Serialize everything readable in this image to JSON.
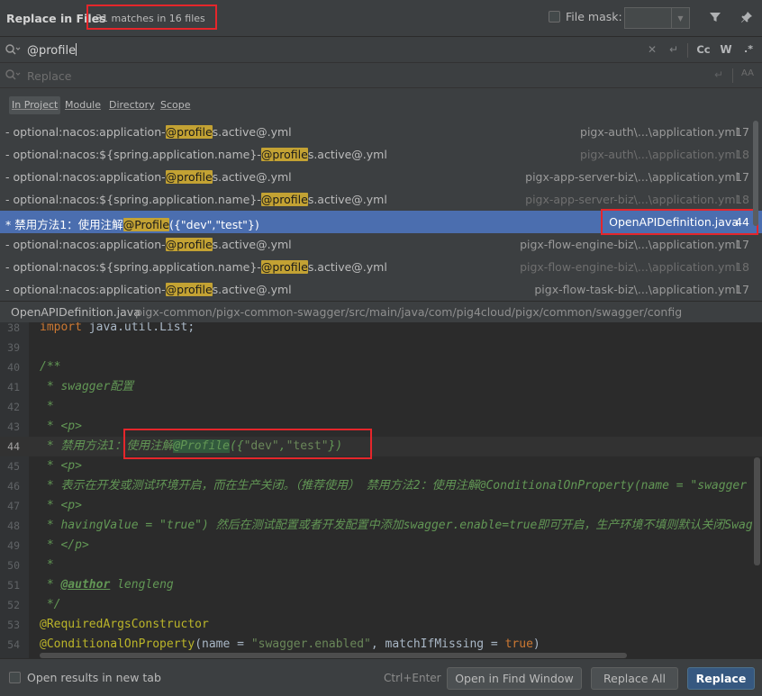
{
  "header": {
    "title": "Replace in Files",
    "match_count": "31 matches in 16 files",
    "file_mask_label": "File mask:",
    "filter_icon": "filter-icon",
    "pin_icon": "pin-icon"
  },
  "find": {
    "value": "@profile",
    "icons": [
      "search-history-icon",
      "clear-icon",
      "newline-icon",
      "match-case-icon",
      "words-icon",
      "regex-icon"
    ],
    "match_case_label": "Cc",
    "words_label": "W",
    "regex_label": ".*"
  },
  "replace": {
    "placeholder": "Replace",
    "preserve_case_label": "AA"
  },
  "scope": {
    "tabs": [
      "In Project",
      "Module",
      "Directory",
      "Scope"
    ],
    "active": "In Project"
  },
  "results": [
    {
      "before": "- optional:nacos:application-",
      "match": "@profile",
      "after": "s.active@.yml",
      "file": "pigx-auth\\...\\application.yml",
      "line": "17",
      "faded": false,
      "selected": false
    },
    {
      "before": "- optional:nacos:${spring.application.name}-",
      "match": "@profile",
      "after": "s.active@.yml",
      "file": "pigx-auth\\...\\application.yml",
      "line": "18",
      "faded": true,
      "selected": false
    },
    {
      "before": "- optional:nacos:application-",
      "match": "@profile",
      "after": "s.active@.yml",
      "file": "pigx-app-server-biz\\...\\application.yml",
      "line": "17",
      "faded": false,
      "selected": false
    },
    {
      "before": "- optional:nacos:${spring.application.name}-",
      "match": "@profile",
      "after": "s.active@.yml",
      "file": "pigx-app-server-biz\\...\\application.yml",
      "line": "18",
      "faded": true,
      "selected": false
    },
    {
      "before": "* 禁用方法1：使用注解",
      "match": "@Profile",
      "after": "({\"dev\",\"test\"})",
      "file": "OpenAPIDefinition.java",
      "line": "44",
      "faded": false,
      "selected": true
    },
    {
      "before": "- optional:nacos:application-",
      "match": "@profile",
      "after": "s.active@.yml",
      "file": "pigx-flow-engine-biz\\...\\application.yml",
      "line": "17",
      "faded": false,
      "selected": false
    },
    {
      "before": "- optional:nacos:${spring.application.name}-",
      "match": "@profile",
      "after": "s.active@.yml",
      "file": "pigx-flow-engine-biz\\...\\application.yml",
      "line": "18",
      "faded": true,
      "selected": false
    },
    {
      "before": "- optional:nacos:application-",
      "match": "@profile",
      "after": "s.active@.yml",
      "file": "pigx-flow-task-biz\\...\\application.yml",
      "line": "17",
      "faded": false,
      "selected": false
    }
  ],
  "path": {
    "file": "OpenAPIDefinition.java",
    "dir": "pigx-common/pigx-common-swagger/src/main/java/com/pig4cloud/pigx/common/swagger/config"
  },
  "editor": {
    "current_line": "44",
    "lines": [
      {
        "n": "38",
        "parts": [
          [
            "c-kw",
            "import "
          ],
          [
            "c-plain",
            "java.util.List;"
          ]
        ]
      },
      {
        "n": "39",
        "parts": []
      },
      {
        "n": "40",
        "parts": [
          [
            "c-doc",
            "/**"
          ]
        ]
      },
      {
        "n": "41",
        "parts": [
          [
            "c-doc",
            " * swagger配置"
          ]
        ]
      },
      {
        "n": "42",
        "parts": [
          [
            "c-doc",
            " *"
          ]
        ]
      },
      {
        "n": "43",
        "parts": [
          [
            "c-doc",
            " * <p>"
          ]
        ]
      },
      {
        "n": "44",
        "parts": [
          [
            "c-doc",
            " * 禁用方法1：使用注解"
          ],
          [
            "c-doc c-hl",
            "@Profile"
          ],
          [
            "c-doc",
            "({"
          ],
          [
            "c-str",
            "\"dev\""
          ],
          [
            "c-doc",
            ","
          ],
          [
            "c-str",
            "\"test\""
          ],
          [
            "c-doc",
            "})"
          ]
        ]
      },
      {
        "n": "45",
        "parts": [
          [
            "c-doc",
            " * <p>"
          ]
        ]
      },
      {
        "n": "46",
        "parts": [
          [
            "c-doc",
            " * 表示在开发或测试环境开启，而在生产关闭。（推荐使用） 禁用方法2：使用注解@ConditionalOnProperty(name = \"swagger"
          ]
        ]
      },
      {
        "n": "47",
        "parts": [
          [
            "c-doc",
            " * <p>"
          ]
        ]
      },
      {
        "n": "48",
        "parts": [
          [
            "c-doc",
            " * havingValue = \"true\") 然后在测试配置或者开发配置中添加swagger.enable=true即可开启，生产环境不填则默认关闭Swag"
          ]
        ]
      },
      {
        "n": "49",
        "parts": [
          [
            "c-doc",
            " * </p>"
          ]
        ]
      },
      {
        "n": "50",
        "parts": [
          [
            "c-doc",
            " *"
          ]
        ]
      },
      {
        "n": "51",
        "parts": [
          [
            "c-doc",
            " * "
          ],
          [
            "c-tag",
            "@author"
          ],
          [
            "c-doc",
            " lengleng"
          ]
        ]
      },
      {
        "n": "52",
        "parts": [
          [
            "c-doc",
            " */"
          ]
        ]
      },
      {
        "n": "53",
        "parts": [
          [
            "c-ann",
            "@RequiredArgsConstructor"
          ]
        ]
      },
      {
        "n": "54",
        "parts": [
          [
            "c-ann",
            "@ConditionalOnProperty"
          ],
          [
            "c-plain",
            "(name = "
          ],
          [
            "c-str",
            "\"swagger.enabled\""
          ],
          [
            "c-plain",
            ", matchIfMissing = "
          ],
          [
            "c-kw",
            "true"
          ],
          [
            "c-plain",
            ")"
          ]
        ]
      }
    ]
  },
  "footer": {
    "open_new_tab_label": "Open results in new tab",
    "shortcut": "Ctrl+Enter",
    "open_find_window_label": "Open in Find Window",
    "replace_all_label": "Replace All",
    "replace_label": "Replace"
  },
  "colors": {
    "background": "#3c3f41",
    "editor_bg": "#2b2b2b",
    "selection": "#4b6eaf",
    "match_highlight": "#c3a233",
    "annotation_box": "#e5262b",
    "primary_button": "#365880"
  }
}
